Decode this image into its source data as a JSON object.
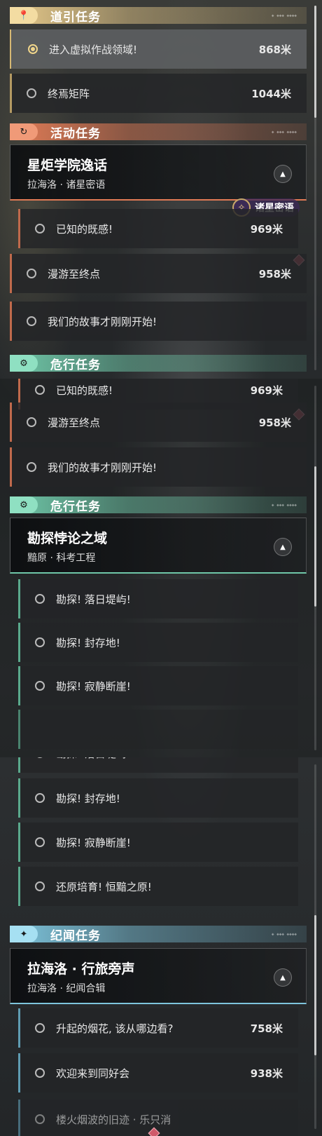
{
  "colors": {
    "guide": "#e6c98a",
    "activity": "#e07a55",
    "danger": "#6fc7a8",
    "chronicle": "#7ec5dd",
    "selected": "#f0d58a",
    "marker": "#d05a6a"
  },
  "categories": {
    "guide": {
      "title": "道引任务",
      "icon": "map-pin-icon",
      "glyph": "📍"
    },
    "activity": {
      "title": "活动任务",
      "icon": "event-icon",
      "glyph": "↻"
    },
    "danger": {
      "title": "危行任务",
      "icon": "gear-icon",
      "glyph": "⚙"
    },
    "chronicle": {
      "title": "纪闻任务",
      "icon": "sparkle-icon",
      "glyph": "✦"
    }
  },
  "guide_tasks": [
    {
      "label": "进入虚拟作战领域!",
      "dist": "868米"
    },
    {
      "label": "终焉矩阵",
      "dist": "1044米"
    }
  ],
  "activity_card": {
    "title": "星炬学院逸话",
    "subtitle": "拉海洛 · 诸星密语"
  },
  "activity_tasks": [
    {
      "label": "已知的既感!",
      "dist": "969米"
    },
    {
      "label": "漫游至终点",
      "dist": "958米"
    },
    {
      "label": "我们的故事才刚刚开始!",
      "dist": ""
    }
  ],
  "callout": {
    "text": "诸星密语",
    "glyph": "✧"
  },
  "danger_card": {
    "title": "勘探悖论之域",
    "subtitle": "黯原 · 科考工程"
  },
  "danger_tasks": [
    {
      "label": "勘探! 落日堤屿!"
    },
    {
      "label": "勘探! 封存地!"
    },
    {
      "label": "勘探! 寂静断崖!"
    },
    {
      "label": "还原培育! 恒黯之原!"
    }
  ],
  "chronicle_card": {
    "title": "拉海洛 · 行旅旁声",
    "subtitle": "拉海洛 · 纪闻合辑"
  },
  "chronicle_tasks": [
    {
      "label": "升起的烟花, 该从哪边看?",
      "dist": "758米"
    },
    {
      "label": "欢迎来到同好会",
      "dist": "938米"
    },
    {
      "label": "楼火烟波的旧迹 · 乐只消",
      "dist": ""
    }
  ],
  "chevron_glyph": "▲"
}
